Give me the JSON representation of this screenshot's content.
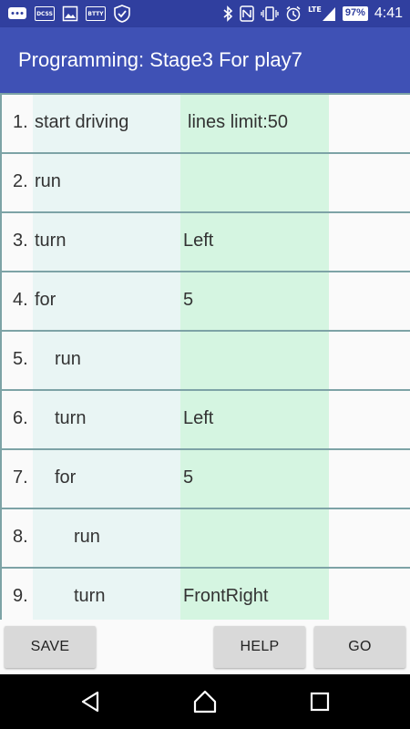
{
  "status_bar": {
    "left_icons": [
      "messages-icon",
      "dcss-icon",
      "image-icon",
      "app-icon",
      "shield-icon"
    ],
    "dcss_label": "DCSS",
    "app_label": "BTTY",
    "lte": "LTE",
    "battery": "97%",
    "time": "4:41"
  },
  "app_bar": {
    "title": "Programming: Stage3 For play7"
  },
  "program": {
    "rows": [
      {
        "num": "1.",
        "cmd": "start driving",
        "arg": "lines limit:50",
        "indent": 0
      },
      {
        "num": "2.",
        "cmd": "run",
        "arg": "",
        "indent": 0
      },
      {
        "num": "3.",
        "cmd": "turn",
        "arg": "Left",
        "indent": 0
      },
      {
        "num": "4.",
        "cmd": "for",
        "arg": "5",
        "indent": 0
      },
      {
        "num": "5.",
        "cmd": "run",
        "arg": "",
        "indent": 1
      },
      {
        "num": "6.",
        "cmd": "turn",
        "arg": "Left",
        "indent": 1
      },
      {
        "num": "7.",
        "cmd": "for",
        "arg": "5",
        "indent": 1
      },
      {
        "num": "8.",
        "cmd": "run",
        "arg": "",
        "indent": 2
      },
      {
        "num": "9.",
        "cmd": "turn",
        "arg": "FrontRight",
        "indent": 2
      }
    ]
  },
  "buttons": {
    "save": "SAVE",
    "help": "HELP",
    "go": "GO"
  },
  "colors": {
    "status_bar": "#303f9f",
    "app_bar": "#3f51b5",
    "column_command": "#e9f5f4",
    "column_argument": "#d5f5e1",
    "row_border": "#7da3a6"
  }
}
